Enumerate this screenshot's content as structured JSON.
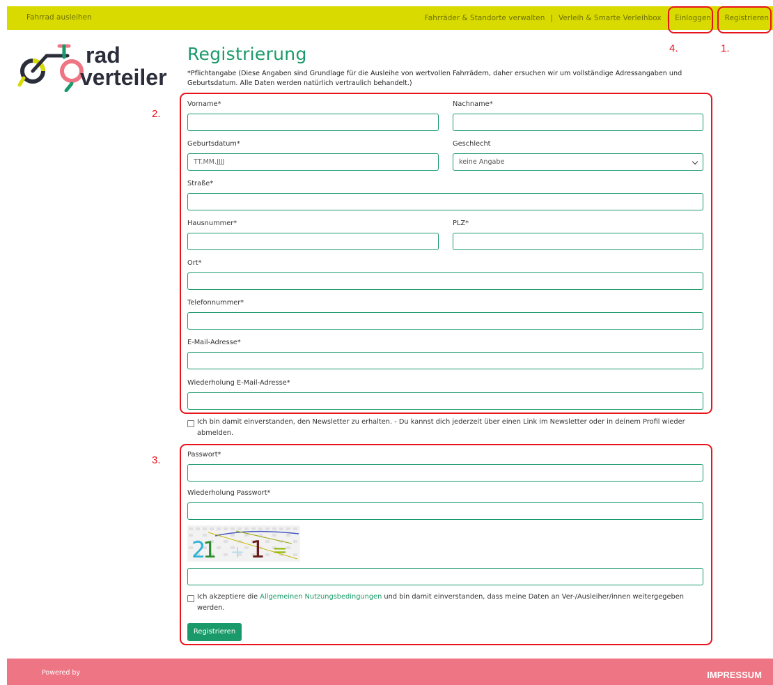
{
  "topbar": {
    "left_link": "Fahrrad ausleihen",
    "nav": [
      "Fahrräder & Standorte verwalten",
      "Verleih & Smarte Verleihbox",
      "Einloggen",
      "Registrieren"
    ],
    "separator": "|"
  },
  "logo": {
    "line1": "rad",
    "line2": "verteiler"
  },
  "page": {
    "title": "Registrierung",
    "intro": "*Pflichtangabe (Diese Angaben sind Grundlage für die Ausleihe von wertvollen Fahrrädern, daher ersuchen wir um vollständige Adressangaben und Geburtsdatum. Alle Daten werden natürlich vertraulich behandelt.)"
  },
  "annotations": {
    "n1": "1.",
    "n2": "2.",
    "n3": "3.",
    "n4": "4."
  },
  "form": {
    "firstname_label": "Vorname*",
    "lastname_label": "Nachname*",
    "birthdate_label": "Geburtsdatum*",
    "birthdate_placeholder": "TT.MM.JJJJ",
    "gender_label": "Geschlecht",
    "gender_value": "keine Angabe",
    "street_label": "Straße*",
    "housenumber_label": "Hausnummer*",
    "zip_label": "PLZ*",
    "city_label": "Ort*",
    "phone_label": "Telefonnummer*",
    "email_label": "E-Mail-Adresse*",
    "email_repeat_label": "Wiederholung E-Mail-Adresse*",
    "newsletter_text": "Ich bin damit einverstanden, den Newsletter zu erhalten. - Du kannst dich jederzeit über einen Link im Newsletter oder in deinem Profil wieder abmelden.",
    "password_label": "Passwort*",
    "password_repeat_label": "Wiederholung Passwort*",
    "captcha_text": "21 + 1 =",
    "terms_prefix": "Ich akzeptiere die ",
    "terms_link": "Allgemeinen Nutzungsbedingungen",
    "terms_suffix": " und bin damit einverstanden, dass meine Daten an Ver-/Ausleiher/innen weitergegeben werden.",
    "submit_label": "Registrieren"
  },
  "footer": {
    "powered_by": "Powered by",
    "impressum": "IMPRESSUM"
  },
  "colors": {
    "topbar": "#d9db00",
    "accent": "#1a9a6a",
    "footer": "#ee7584",
    "annotation": "#e8141a"
  }
}
